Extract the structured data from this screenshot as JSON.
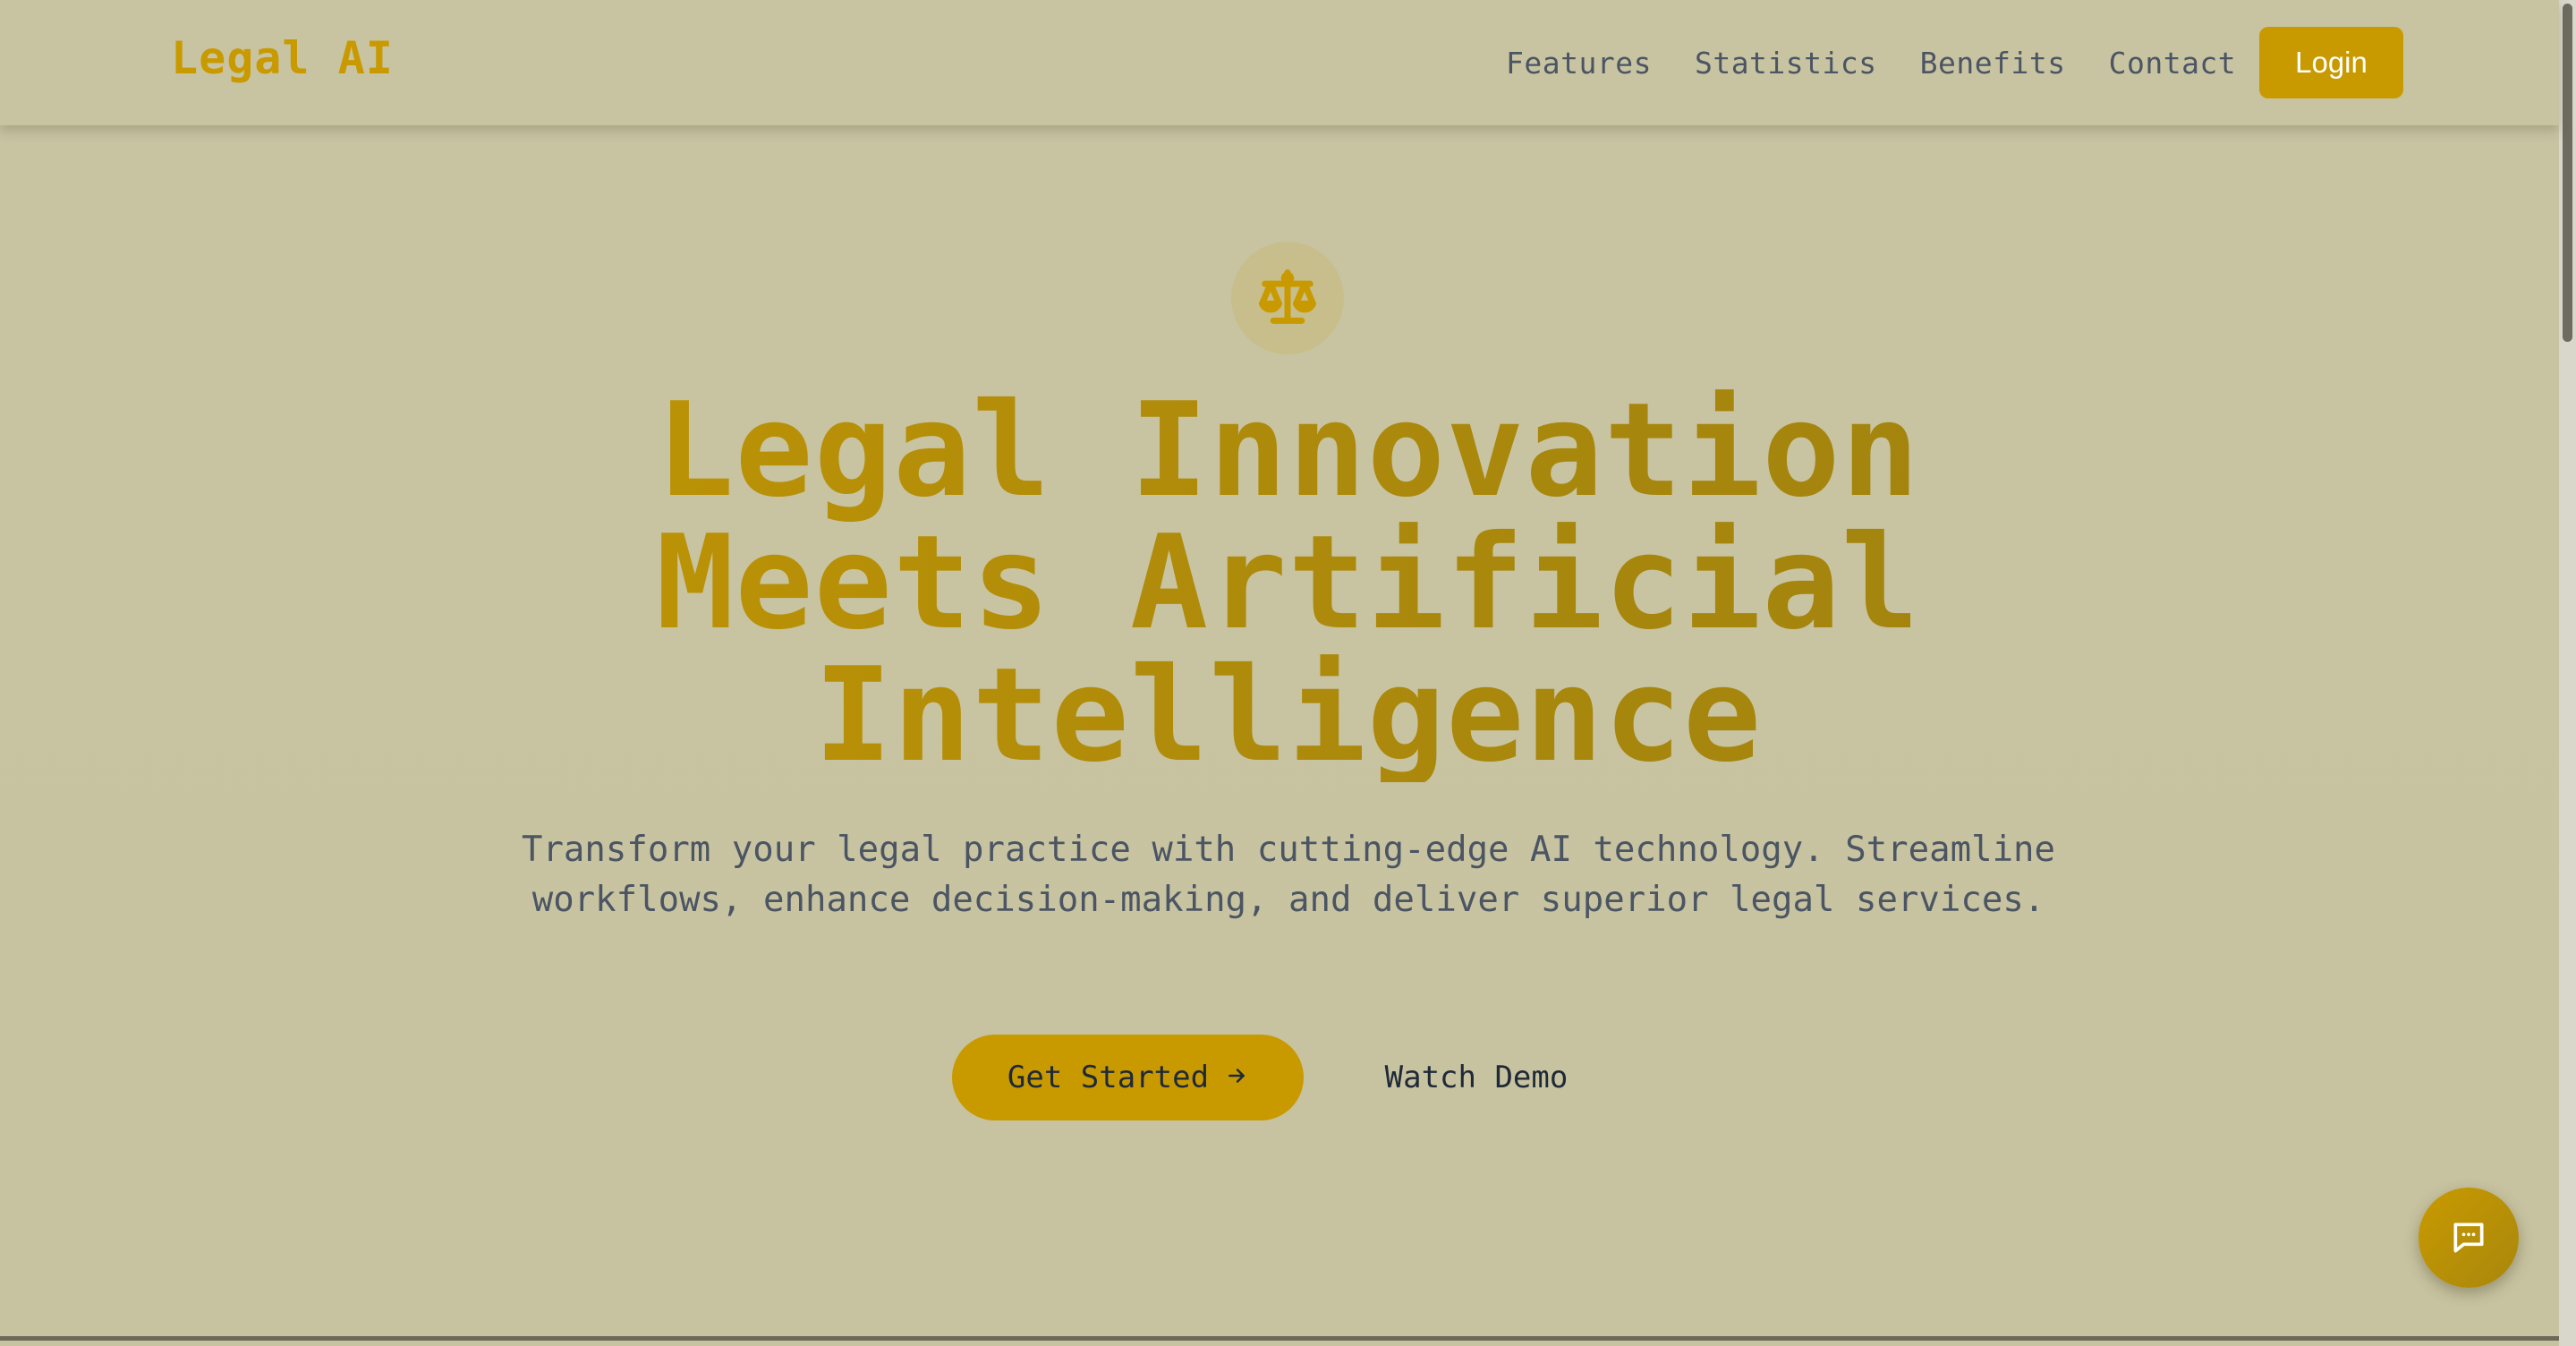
{
  "header": {
    "brand": "Legal AI",
    "nav": [
      {
        "label": "Features"
      },
      {
        "label": "Statistics"
      },
      {
        "label": "Benefits"
      },
      {
        "label": "Contact"
      }
    ],
    "login_label": "Login"
  },
  "hero": {
    "icon": "scale-icon",
    "title_lines": [
      "Legal Innovation",
      "Meets Artificial",
      "Intelligence"
    ],
    "subtitle": "Transform your legal practice with cutting-edge AI technology. Streamline workflows, enhance decision-making, and deliver superior legal services.",
    "primary_cta": "Get Started",
    "primary_cta_icon": "arrow-right-icon",
    "secondary_cta": "Watch Demo"
  },
  "chat": {
    "icon": "chat-bubble-icon"
  },
  "colors": {
    "accent": "#c99a00",
    "background": "#c8c4a2",
    "text": "#4b5563",
    "dark_text": "#1f2937"
  }
}
